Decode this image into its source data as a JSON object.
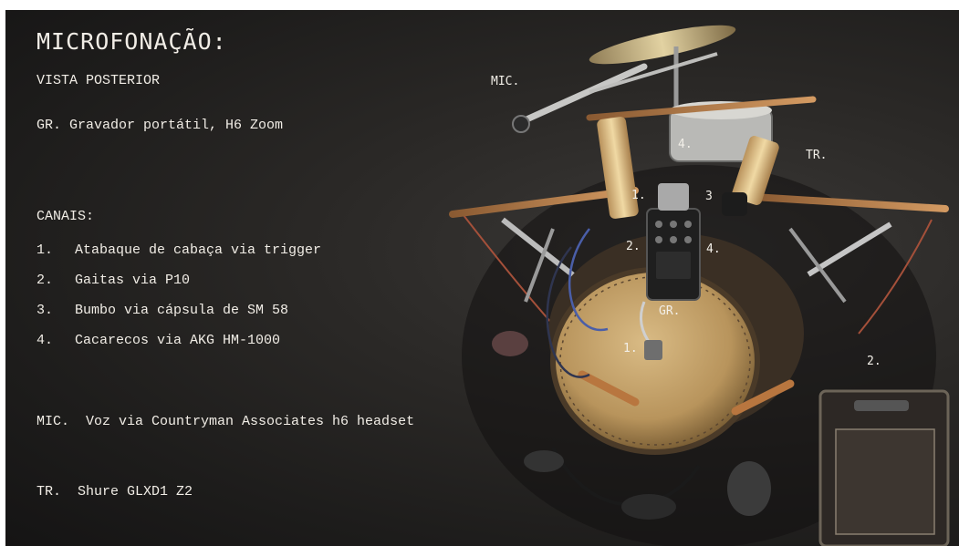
{
  "title": "MICROFONAÇÃO:",
  "subtitle": "VISTA POSTERIOR",
  "recorder": "GR. Gravador portátil, H6 Zoom",
  "channels_heading": "CANAIS:",
  "channels": [
    {
      "num": "1.",
      "text": "Atabaque de cabaça via trigger"
    },
    {
      "num": "2.",
      "text": "Gaitas via P10"
    },
    {
      "num": "3.",
      "text": "Bumbo via cápsula de SM 58"
    },
    {
      "num": "4.",
      "text": "Cacarecos via AKG HM-1000"
    }
  ],
  "mic_line": "MIC.  Voz via Countryman Associates h6 headset",
  "tr_line": "TR.  Shure GLXD1 Z2",
  "photo_labels": {
    "mic": "MIC.",
    "tr": "TR.",
    "gr": "GR.",
    "ch4_top": "4.",
    "ch1_top": "1.",
    "ch3": "3",
    "ch2": "2.",
    "ch4": "4.",
    "ch1_drum": "1.",
    "ch2_right": "2."
  },
  "colors": {
    "background": "#252321",
    "text": "#f1ede6",
    "drumhead": "#c8a66e",
    "wood": "#b8895a"
  }
}
